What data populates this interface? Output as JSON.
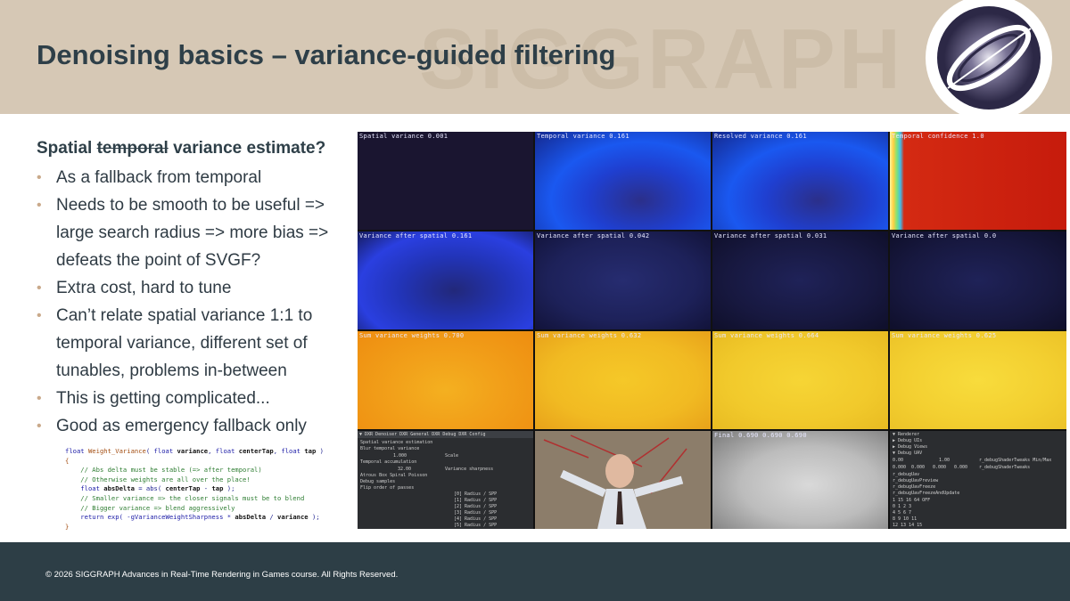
{
  "header": {
    "title": "Denoising basics – variance-guided filtering",
    "watermark": "SIGGRAPH",
    "logo_icon": "siggraph-logo-icon"
  },
  "subheading": {
    "prefix": "Spatial ",
    "struck": "temporal",
    "suffix": " variance estimate?"
  },
  "bullets": [
    "As a fallback from temporal",
    "Needs to be smooth to be useful => large search radius => more bias => defeats the point of SVGF?",
    "Extra cost, hard to tune",
    "Can’t relate spatial variance 1:1 to temporal variance, different set of tunables, problems in-between",
    "This is getting complicated...",
    "Good as emergency fallback only"
  ],
  "code": {
    "line1_type": "float ",
    "line1_fn": "Weight_Variance",
    "line1_open": "( ",
    "line1_p1t": "float ",
    "line1_p1": "variance",
    "line1_c1": ", ",
    "line1_p2t": "float ",
    "line1_p2": "centerTap",
    "line1_c2": ", ",
    "line1_p3t": "float ",
    "line1_p3": "tap",
    "line1_close": " )",
    "line2": "{",
    "line3": "    // Abs delta must be stable (=> after temporal)",
    "line4": "    // Otherwise weights are all over the place!",
    "line5_a": "    float ",
    "line5_b": "absDelta",
    "line5_c": " = abs( ",
    "line5_d": "centerTap",
    "line5_e": " - ",
    "line5_f": "tap",
    "line5_g": " );",
    "line6": "    // Smaller variance => the closer signals must be to blend",
    "line7": "    // Bigger variance => blend aggressively",
    "line8_a": "    return exp( -gVarianceWeightSharpness * ",
    "line8_b": "absDelta",
    "line8_c": " / ",
    "line8_d": "variance",
    "line8_e": " );",
    "line9": "}"
  },
  "tiles": {
    "r1": [
      "Spatial variance 0.001",
      "Temporal variance 0.161",
      "Resolved variance 0.161",
      "Temporal confidence 1.0"
    ],
    "r2": [
      "Variance after spatial 0.161",
      "Variance after spatial 0.042",
      "Variance after spatial 0.031",
      "Variance after spatial 0.0"
    ],
    "r3": [
      "Sum variance weights 0.700",
      "Sum variance weights 0.632",
      "Sum variance weights 0.664",
      "Sum variance weights 0.625"
    ],
    "r4_final": "Final 0.690 0.690 0.690"
  },
  "debug_left": {
    "bar": "▼ DXR Denoiser DXR General DXR Debug DXR Config",
    "lines": [
      "Spatial variance estimation",
      "Blur temporal variance",
      "1.000",
      "Scale",
      "Temporal accumulation",
      "32.00",
      "Variance sharpness",
      "Atrous   Box   Spiral   Poisson",
      "Debug samples",
      "Flip order of passes",
      "[0] Radius / SPP",
      "[1] Radius / SPP",
      "[2] Radius / SPP",
      "[3] Radius / SPP",
      "[4] Radius / SPP",
      "[5] Radius / SPP"
    ]
  },
  "debug_right": {
    "lines": [
      "▼ Renderer",
      "▶ Debug UIs",
      "▶ Debug Views",
      "▼ Debug UAV",
      "0.00",
      "1.00",
      "r_debugShaderTweaks Min/Max",
      "0.000",
      "0.000",
      "0.000",
      "0.000",
      "r_debugShaderTweaks",
      "r_debugUav",
      "r_debugUavPreview",
      "r_debugUavFreeze",
      "r_debugUavFreezeAndUpdate",
      "1  15  16  64  OFF",
      "0  1  2  3",
      "4  5  6  7",
      "8  9  10  11",
      "12  13  14  15"
    ]
  },
  "footer": {
    "copyright": "© 2026 SIGGRAPH Advances in Real-Time Rendering in Games course. All Rights Reserved."
  },
  "colors": {
    "header_bg": "#d6c8b5",
    "title": "#2e3f48",
    "bullet_marker": "#c9a98a",
    "footer_bg": "#2d3e46"
  }
}
